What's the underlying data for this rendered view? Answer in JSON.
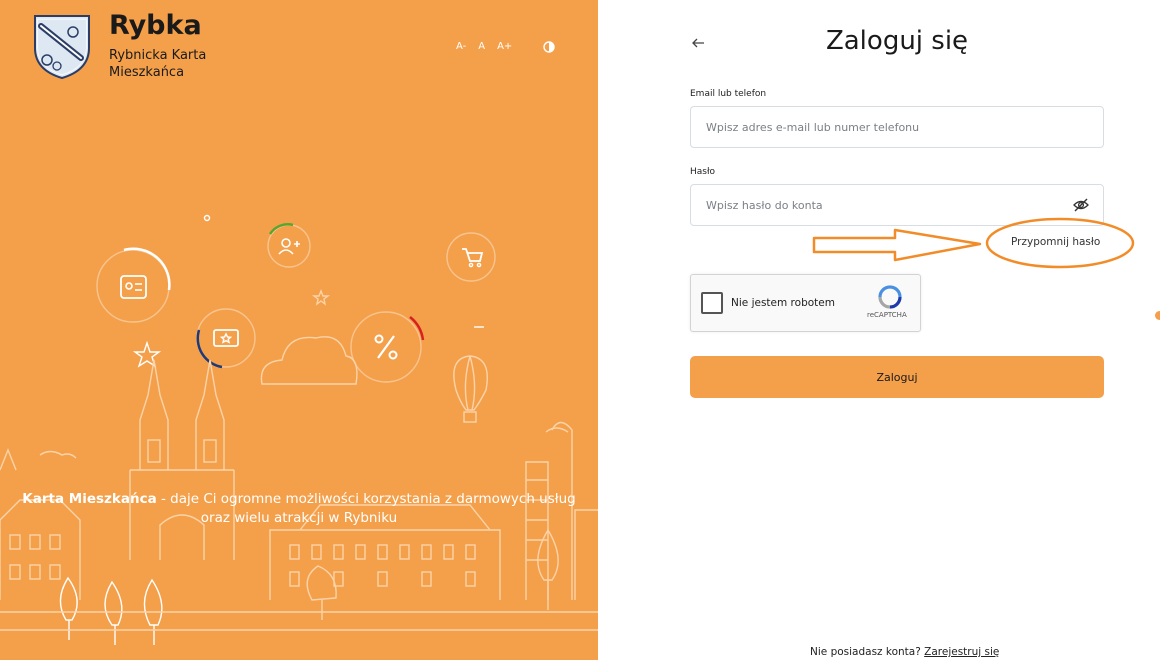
{
  "brand": {
    "title": "Rybka",
    "subtitle": "Rybnicka Karta Mieszkańca"
  },
  "font_controls": {
    "decrease": "A-",
    "normal": "A",
    "increase": "A+"
  },
  "tagline": {
    "bold": "Karta Mieszkańca",
    "rest": " - daje Ci ogromne możliwości korzystania z darmowych usług oraz wielu atrakcji w Rybniku"
  },
  "login": {
    "title": "Zaloguj się",
    "email_label": "Email lub telefon",
    "email_placeholder": "Wpisz adres e-mail lub numer telefonu",
    "email_value": "",
    "password_label": "Hasło",
    "password_placeholder": "Wpisz hasło do konta",
    "password_value": "",
    "remind_link": "Przypomnij hasło",
    "submit_label": "Zaloguj"
  },
  "captcha": {
    "label": "Nie jestem robotem",
    "brand": "reCAPTCHA",
    "checked": false
  },
  "register": {
    "prompt": "Nie posiadasz konta?",
    "link": "Zarejestruj się"
  },
  "colors": {
    "accent": "#f4a04b",
    "annotation": "#f28c28"
  },
  "icons": [
    "crest-logo",
    "contrast-icon",
    "back-arrow-icon",
    "eye-slash-icon",
    "recaptcha-icon",
    "id-card-icon",
    "user-plus-icon",
    "cart-icon",
    "ticket-icon",
    "percent-icon",
    "cloud-icon",
    "balloon-icon",
    "star-icon"
  ]
}
